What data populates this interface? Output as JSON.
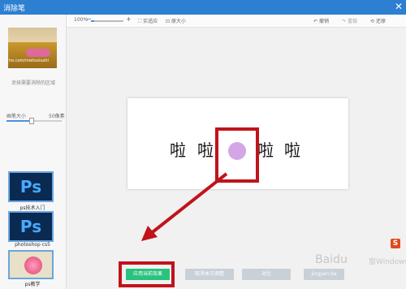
{
  "window": {
    "title": "消除笔",
    "close": "✕"
  },
  "left_panel": {
    "thumbnail_watermark": "ho.com/meitusiushi",
    "hint": "涂抹需要消除的区域",
    "brush_label": "画笔大小",
    "brush_value": "50像素",
    "brush_level": 0.45,
    "lessons": [
      {
        "label": "ps技术入门",
        "icon": "Ps"
      },
      {
        "label": "photoshop cs5",
        "icon": "Ps"
      },
      {
        "label": "ps教学"
      }
    ]
  },
  "toolbar": {
    "zoom": "100%",
    "zoom_minus": "−",
    "zoom_plus": "+",
    "zoom_level": 0.1,
    "fit": "实适应",
    "original": "原大小",
    "undo": "撤销",
    "redo": "重做",
    "reset": "还原"
  },
  "document": {
    "chars": [
      "啦",
      "啦",
      "啦",
      "啦"
    ]
  },
  "buttons": {
    "apply": "应用当前效果",
    "cancel": "取消本次调整",
    "compare": "对比",
    "extra": "jingyan.ba"
  },
  "watermark": {
    "baidu": "Baidu",
    "windows": "窗Windows",
    "logo": "S"
  },
  "colors": {
    "titlebar": "#2c7fd1",
    "apply_button": "#29c27f",
    "highlight": "#c0141a",
    "eraser_dot": "#d3a6e6"
  }
}
